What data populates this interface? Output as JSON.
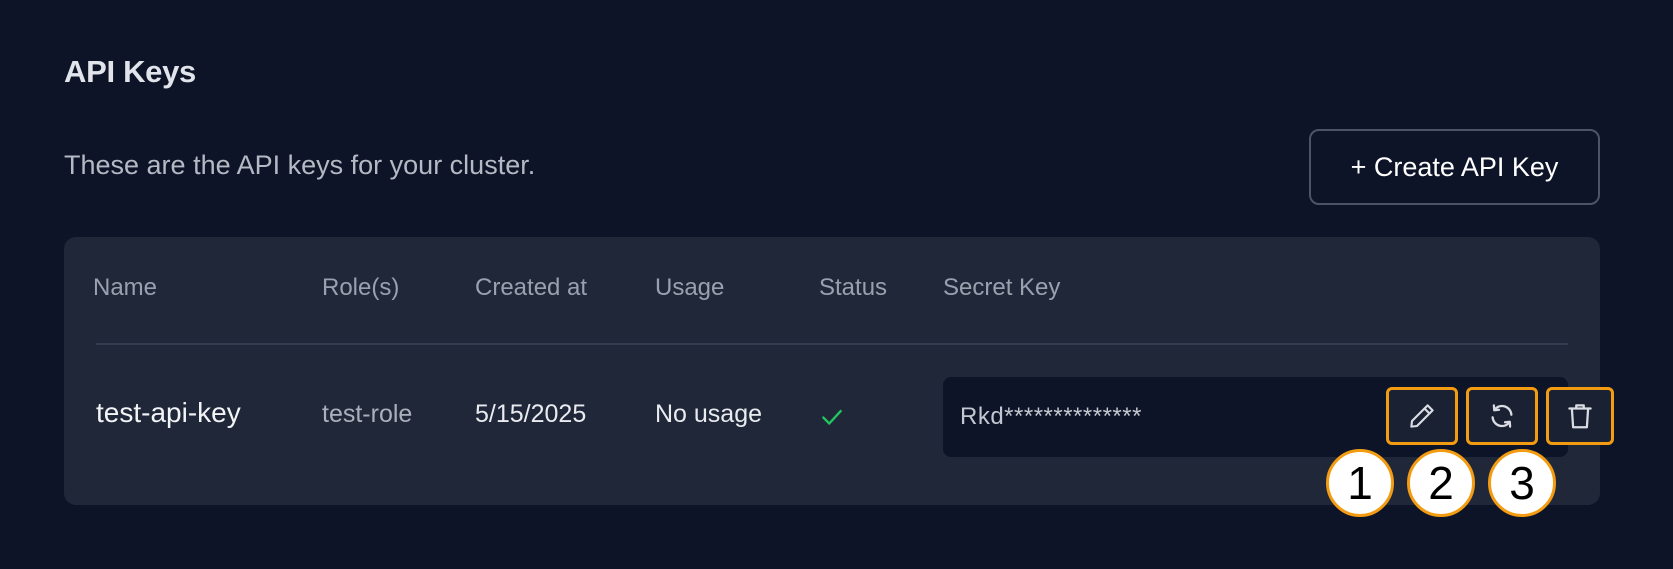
{
  "section": {
    "title": "API Keys",
    "description": "These are the API keys for your cluster."
  },
  "create_button": {
    "label": "+ Create API Key"
  },
  "table": {
    "headers": {
      "name": "Name",
      "roles": "Role(s)",
      "created_at": "Created at",
      "usage": "Usage",
      "status": "Status",
      "secret_key": "Secret Key"
    },
    "rows": [
      {
        "name": "test-api-key",
        "role": "test-role",
        "created_at": "5/15/2025",
        "usage": "No usage",
        "status_icon": "checkmark-icon",
        "secret_key": "Rkd**************",
        "actions": [
          "edit-icon",
          "refresh-icon",
          "trash-icon"
        ]
      }
    ]
  },
  "callouts": [
    "1",
    "2",
    "3"
  ],
  "colors": {
    "background": "#0e1427",
    "card": "#1f2739",
    "highlight": "#f39c12",
    "status_ok": "#22c55e"
  }
}
